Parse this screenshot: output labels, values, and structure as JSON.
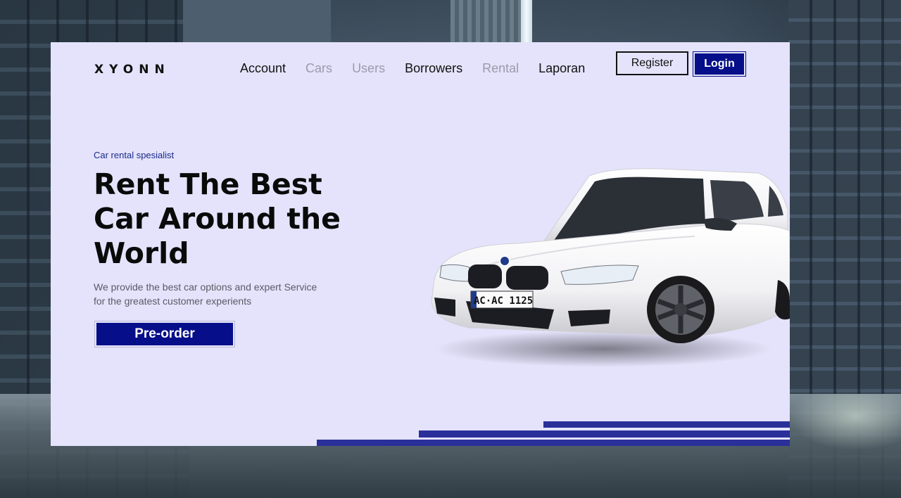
{
  "header": {
    "logo": "XYONN",
    "nav": [
      {
        "label": "Account",
        "active": true
      },
      {
        "label": "Cars",
        "active": false
      },
      {
        "label": "Users",
        "active": false
      },
      {
        "label": "Borrowers",
        "active": true
      },
      {
        "label": "Rental",
        "active": false
      },
      {
        "label": "Laporan",
        "active": true
      }
    ],
    "register_label": "Register",
    "login_label": "Login"
  },
  "hero": {
    "tagline": "Car rental spesialist",
    "headline": "Rent The Best Car Around the World",
    "description": "We provide the best car options and expert Service for the greatest customer experients",
    "preorder_label": "Pre-order"
  },
  "car": {
    "plate": "AC·AC 1125"
  },
  "colors": {
    "accent": "#070e8a",
    "card_background": "#e4e3fb",
    "stripe": "#2a2f9a",
    "muted_nav": "#9b9bab"
  }
}
